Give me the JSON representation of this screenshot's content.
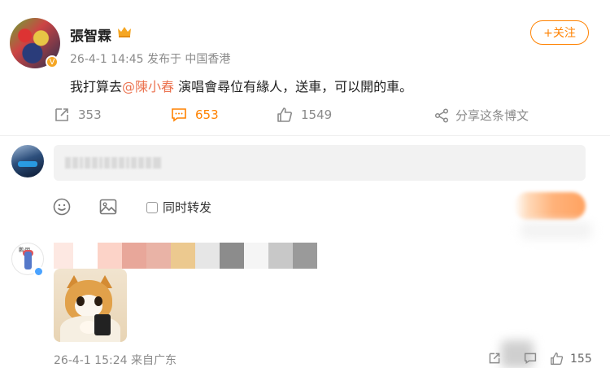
{
  "post": {
    "author": "張智霖",
    "meta": "26-4-1 14:45  发布于 中国香港",
    "follow_label": "+关注",
    "content_before": "我打算去",
    "mention": "@陳小春",
    "content_after": " 演唱會尋位有緣人，送車，可以開的車。",
    "reposts": "353",
    "comments": "653",
    "likes": "1549",
    "share_label": "分享这条博文"
  },
  "composer": {
    "repost_label": "同时转发"
  },
  "reply": {
    "meta": "26-4-1 15:24  来自广东",
    "likes": "155"
  },
  "colors": {
    "accent": "#ff8200",
    "mention": "#eb7350",
    "muted": "#8a8a8a"
  },
  "icons": [
    "vip-crown-icon",
    "repost-icon",
    "comment-icon",
    "like-icon",
    "share-icon",
    "emoji-icon",
    "image-icon"
  ]
}
